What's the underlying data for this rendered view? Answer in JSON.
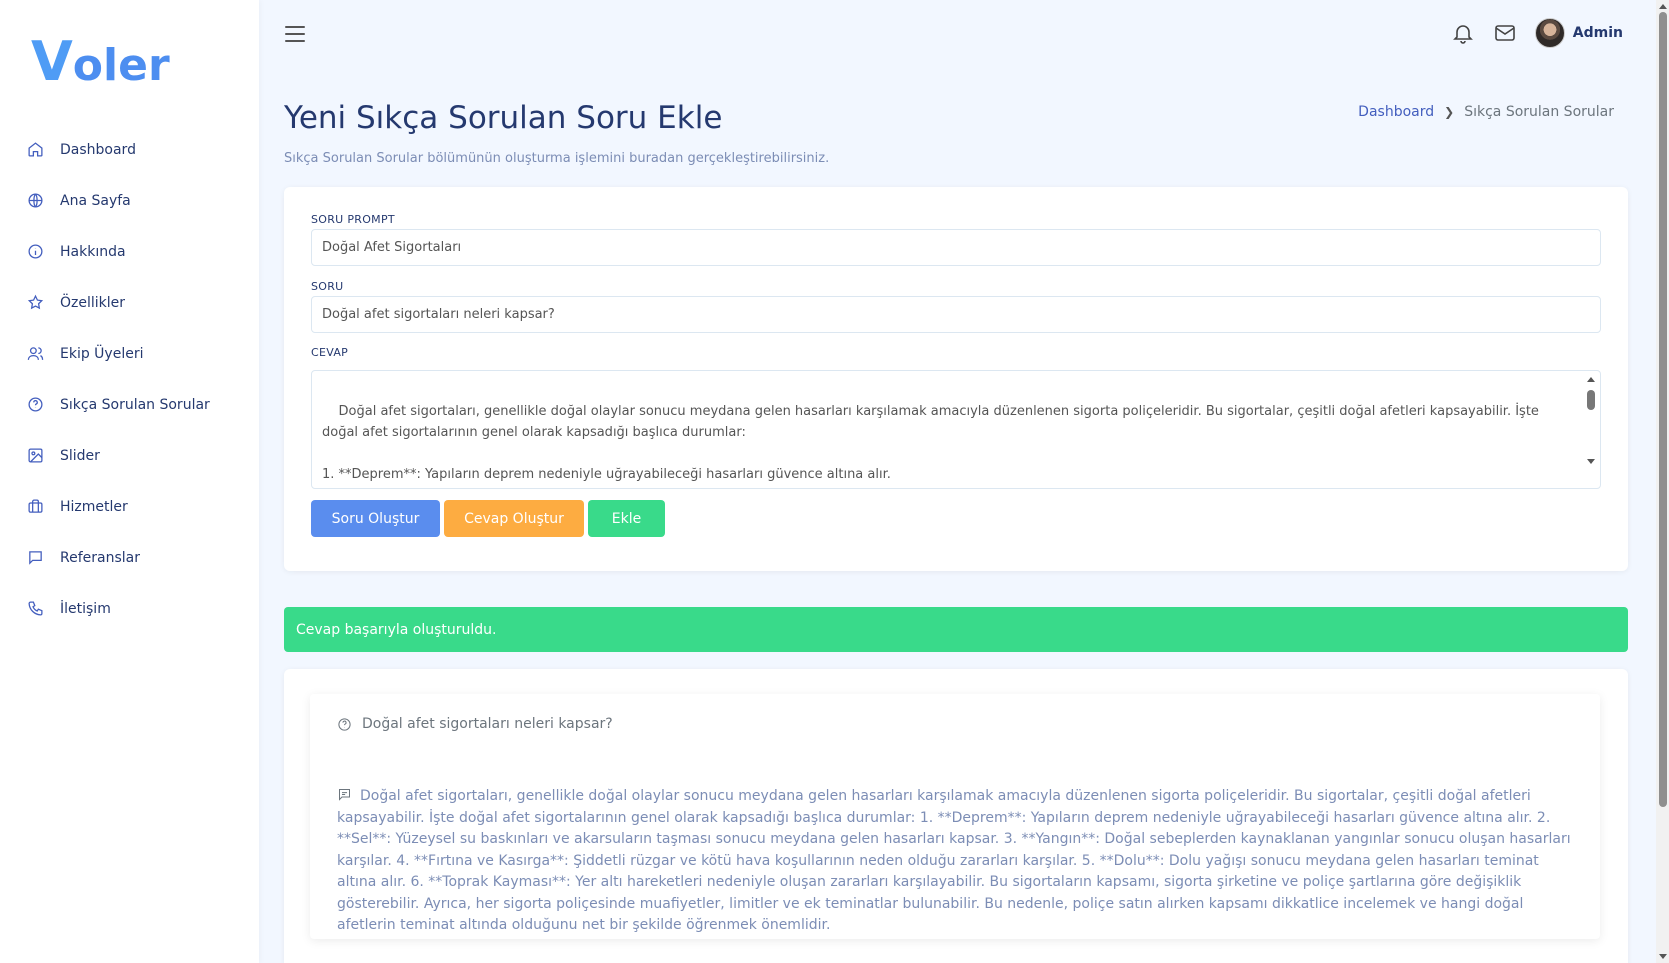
{
  "brand": {
    "logo_first": "V",
    "logo_rest": "oler"
  },
  "sidebar": {
    "items": [
      {
        "label": "Dashboard",
        "icon": "home-icon"
      },
      {
        "label": "Ana Sayfa",
        "icon": "globe-icon"
      },
      {
        "label": "Hakkında",
        "icon": "info-icon"
      },
      {
        "label": "Özellikler",
        "icon": "star-icon"
      },
      {
        "label": "Ekip Üyeleri",
        "icon": "users-icon"
      },
      {
        "label": "Sıkça Sorulan Sorular",
        "icon": "question-icon"
      },
      {
        "label": "Slider",
        "icon": "image-icon"
      },
      {
        "label": "Hizmetler",
        "icon": "briefcase-icon"
      },
      {
        "label": "Referanslar",
        "icon": "message-icon"
      },
      {
        "label": "İletişim",
        "icon": "phone-icon"
      }
    ]
  },
  "topbar": {
    "user_name": "Admin"
  },
  "page": {
    "title": "Yeni Sıkça Sorulan Soru Ekle",
    "subtitle": "Sıkça Sorulan Sorular bölümünün oluşturma işlemini buradan gerçekleştirebilirsiniz."
  },
  "breadcrumb": {
    "link": "Dashboard",
    "current": "Sıkça Sorulan Sorular"
  },
  "form": {
    "prompt_label": "SORU PROMPT",
    "prompt_value": "Doğal Afet Sigortaları",
    "question_label": "SORU",
    "question_value": "Doğal afet sigortaları neleri kapsar?",
    "answer_label": "CEVAP",
    "answer_value": "Doğal afet sigortaları, genellikle doğal olaylar sonucu meydana gelen hasarları karşılamak amacıyla düzenlenen sigorta poliçeleridir. Bu sigortalar, çeşitli doğal afetleri kapsayabilir. İşte doğal afet sigortalarının genel olarak kapsadığı başlıca durumlar:\n\n1. **Deprem**: Yapıların deprem nedeniyle uğrayabileceği hasarları güvence altına alır.\n\n2. **Sel**: Yüzeysel su baskınları ve akarsuların taşması sonucu meydana gelen hasarları kapsar.",
    "btn_generate_question": "Soru Oluştur",
    "btn_generate_answer": "Cevap Oluştur",
    "btn_add": "Ekle"
  },
  "alert": {
    "message": "Cevap başarıyla oluşturuldu."
  },
  "result": {
    "question": "Doğal afet sigortaları neleri kapsar?",
    "answer": "Doğal afet sigortaları, genellikle doğal olaylar sonucu meydana gelen hasarları karşılamak amacıyla düzenlenen sigorta poliçeleridir. Bu sigortalar, çeşitli doğal afetleri kapsayabilir. İşte doğal afet sigortalarının genel olarak kapsadığı başlıca durumlar: 1. **Deprem**: Yapıların deprem nedeniyle uğrayabileceği hasarları güvence altına alır. 2. **Sel**: Yüzeysel su baskınları ve akarsuların taşması sonucu meydana gelen hasarları kapsar. 3. **Yangın**: Doğal sebeplerden kaynaklanan yangınlar sonucu oluşan hasarları karşılar. 4. **Fırtına ve Kasırga**: Şiddetli rüzgar ve kötü hava koşullarının neden olduğu zararları karşılar. 5. **Dolu**: Dolu yağışı sonucu meydana gelen hasarları teminat altına alır. 6. **Toprak Kayması**: Yer altı hareketleri nedeniyle oluşan zararları karşılayabilir. Bu sigortaların kapsamı, sigorta şirketine ve poliçe şartlarına göre değişiklik gösterebilir. Ayrıca, her sigorta poliçesinde muafiyetler, limitler ve ek teminatlar bulunabilir. Bu nedenle, poliçe satın alırken kapsamı dikkatlice incelemek ve hangi doğal afetlerin teminat altında olduğunu net bir şekilde öğrenmek önemlidir."
  },
  "colors": {
    "primary": "#435ebe",
    "success": "#39da8a",
    "warning": "#fdac41",
    "info": "#5a8dee"
  }
}
